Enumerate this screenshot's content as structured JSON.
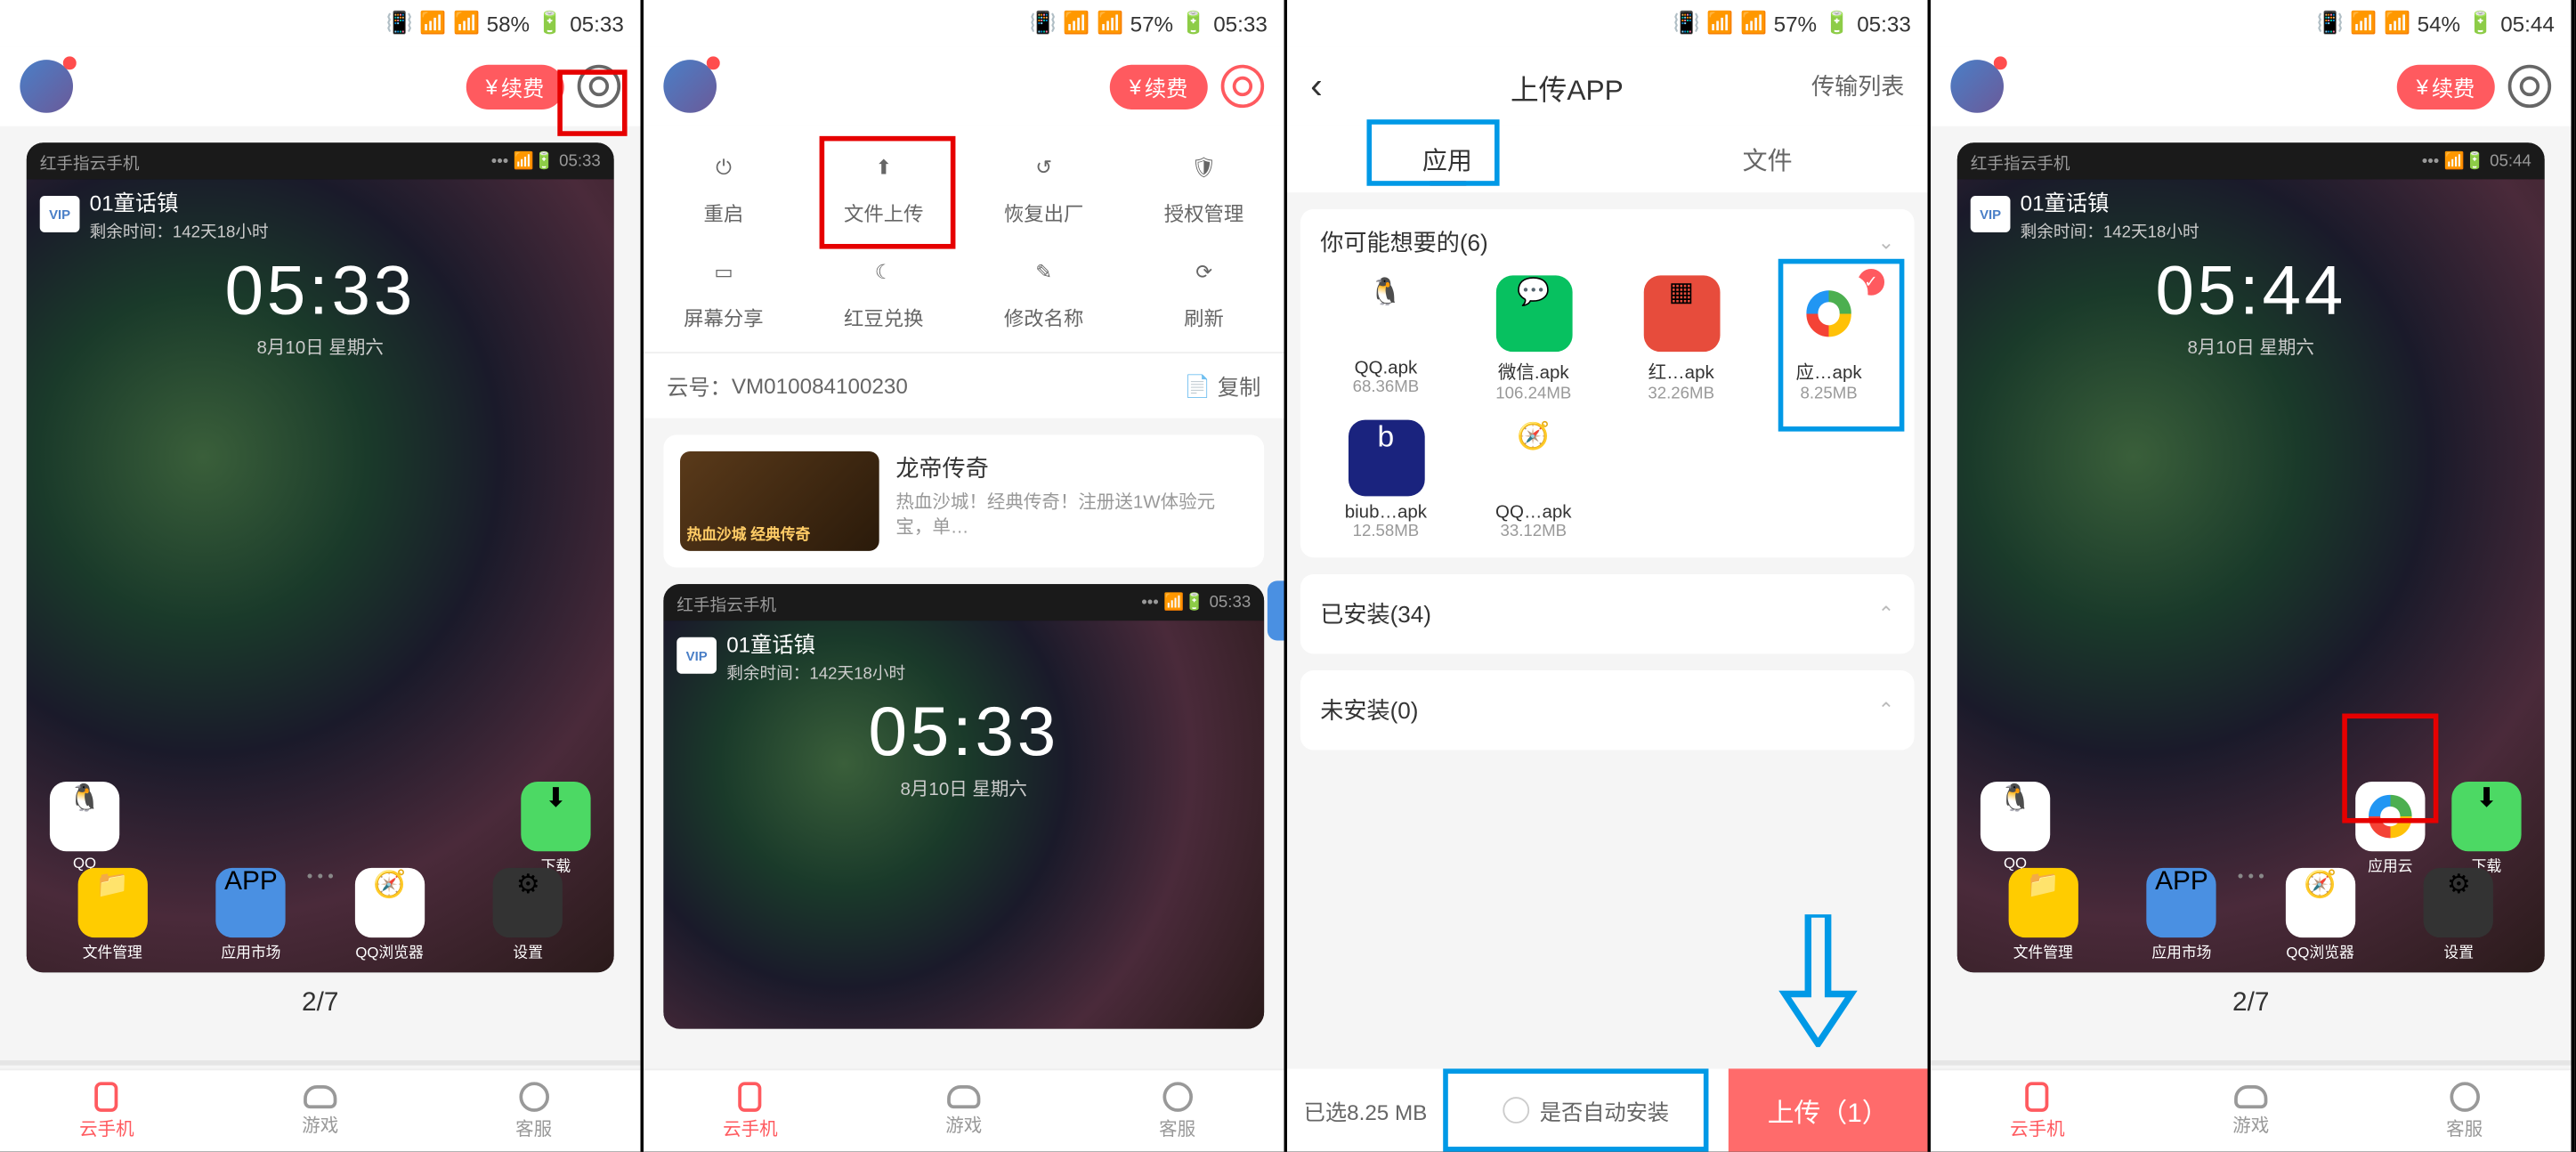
{
  "p1": {
    "status": {
      "battery": "58%",
      "time": "05:33"
    },
    "renew": "续费",
    "phone": {
      "status_left": "红手指云手机",
      "status_right": "05:33",
      "vip": "VIP",
      "title": "01童话镇",
      "subtitle": "剩余时间：142天18小时",
      "clock": "05:33",
      "date": "8月10日 星期六",
      "icons": {
        "qq": "QQ",
        "dl": "下载"
      },
      "dock": {
        "fm": "文件管理",
        "app": "应用市场",
        "qb": "QQ浏览器",
        "set": "设置"
      }
    },
    "page": "2/7",
    "nav": {
      "phone": "云手机",
      "game": "游戏",
      "cs": "客服"
    }
  },
  "p2": {
    "status": {
      "battery": "57%",
      "time": "05:33"
    },
    "renew": "续费",
    "actions": {
      "restart": "重启",
      "upload": "文件上传",
      "factory": "恢复出厂",
      "auth": "授权管理",
      "share": "屏幕分享",
      "bean": "红豆兑换",
      "rename": "修改名称",
      "refresh": "刷新"
    },
    "cloud_label": "云号：",
    "cloud_id": "VM010084100230",
    "copy": "复制",
    "promo": {
      "title": "龙帝传奇",
      "desc": "热血沙城！经典传奇！注册送1W体验元宝，单…"
    },
    "phone": {
      "status_left": "红手指云手机",
      "status_right": "05:33",
      "vip": "VIP",
      "title": "01童话镇",
      "subtitle": "剩余时间：142天18小时",
      "clock": "05:33",
      "date": "8月10日 星期六"
    },
    "nav": {
      "phone": "云手机",
      "game": "游戏",
      "cs": "客服"
    }
  },
  "p3": {
    "status": {
      "battery": "57%",
      "time": "05:33"
    },
    "title": "上传APP",
    "right": "传输列表",
    "tabs": {
      "app": "应用",
      "file": "文件"
    },
    "suggest": "你可能想要的(6)",
    "apps": [
      {
        "name": "QQ.apk",
        "size": "68.36MB"
      },
      {
        "name": "微信.apk",
        "size": "106.24MB"
      },
      {
        "name": "红…apk",
        "size": "32.26MB"
      },
      {
        "name": "应…apk",
        "size": "8.25MB"
      },
      {
        "name": "biub…apk",
        "size": "12.58MB"
      },
      {
        "name": "QQ…apk",
        "size": "33.12MB"
      }
    ],
    "installed": "已安装(34)",
    "notinstalled": "未安装(0)",
    "selected": "已选8.25 MB",
    "auto": "是否自动安装",
    "upload": "上传（1）"
  },
  "p4": {
    "status": {
      "battery": "54%",
      "time": "05:44"
    },
    "renew": "续费",
    "phone": {
      "status_left": "红手指云手机",
      "status_right": "05:44",
      "vip": "VIP",
      "title": "01童话镇",
      "subtitle": "剩余时间：142天18小时",
      "clock": "05:44",
      "date": "8月10日 星期六",
      "icons": {
        "qq": "QQ",
        "cloud": "应用云",
        "dl": "下载"
      },
      "dock": {
        "fm": "文件管理",
        "app": "应用市场",
        "qb": "QQ浏览器",
        "set": "设置"
      }
    },
    "page": "2/7",
    "nav": {
      "phone": "云手机",
      "game": "游戏",
      "cs": "客服"
    }
  }
}
